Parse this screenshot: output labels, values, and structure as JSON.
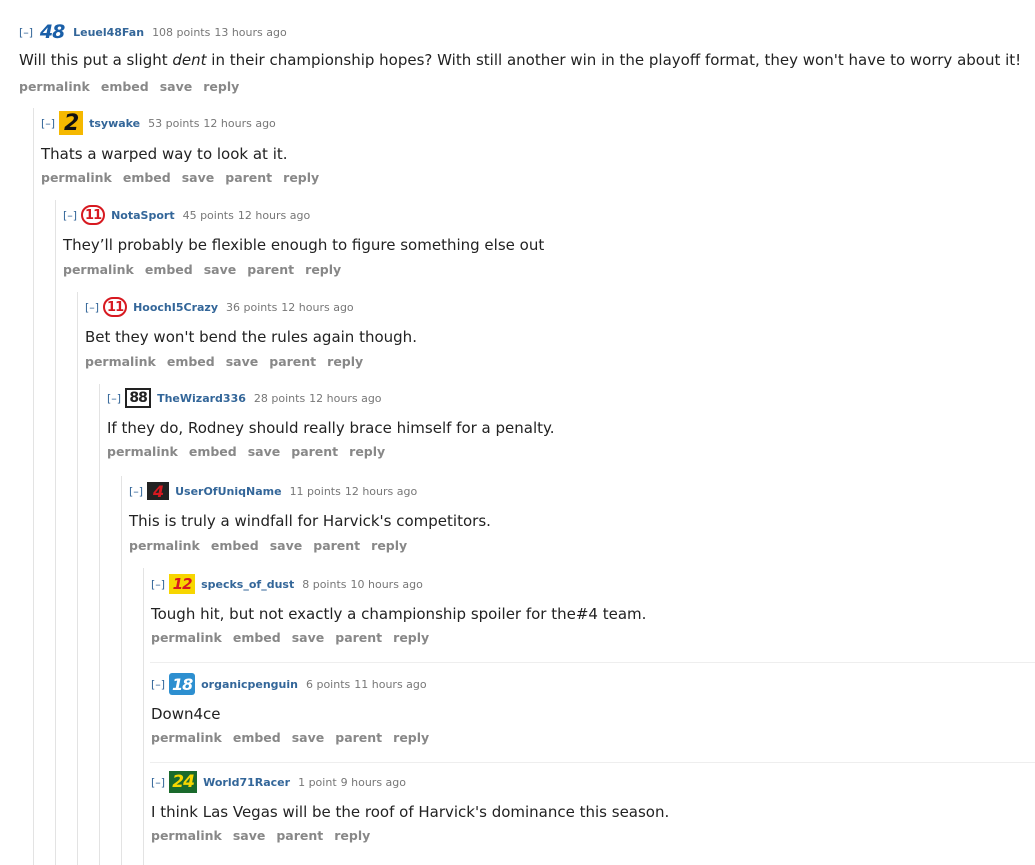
{
  "colors": {
    "link": "#336699",
    "muted": "#888888",
    "rail": "#e3e3e3"
  },
  "collapse_label": "[–]",
  "comments": [
    {
      "author": "Leuel48Fan",
      "points": "108 points",
      "time": "13 hours ago",
      "flair": {
        "text": "48",
        "icon": "flair-48-icon",
        "bg": "#ffffff",
        "fg": "#1a5fa8"
      },
      "body_pre": "Will this put a slight ",
      "body_em": "dent",
      "body_post": " in their championship hopes? With still another win in the playoff format, they won't have to worry about it!",
      "buttons": [
        "permalink",
        "embed",
        "save",
        "reply"
      ]
    },
    {
      "author": "tsywake",
      "points": "53 points",
      "time": "12 hours ago",
      "flair": {
        "text": "2",
        "icon": "flair-2-icon",
        "bg": "#f5b800",
        "fg": "#111111"
      },
      "body": "Thats a warped way to look at it.",
      "buttons": [
        "permalink",
        "embed",
        "save",
        "parent",
        "reply"
      ]
    },
    {
      "author": "NotaSport",
      "points": "45 points",
      "time": "12 hours ago",
      "flair": {
        "text": "11",
        "icon": "flair-11-icon",
        "bg": "#ffffff",
        "fg": "#d71920"
      },
      "body": "They’ll probably be flexible enough to figure something else out",
      "buttons": [
        "permalink",
        "embed",
        "save",
        "parent",
        "reply"
      ]
    },
    {
      "author": "HoochI5Crazy",
      "points": "36 points",
      "time": "12 hours ago",
      "flair": {
        "text": "11",
        "icon": "flair-11-icon",
        "bg": "#ffffff",
        "fg": "#d71920"
      },
      "body": "Bet they won't bend the rules again though.",
      "buttons": [
        "permalink",
        "embed",
        "save",
        "parent",
        "reply"
      ]
    },
    {
      "author": "TheWizard336",
      "points": "28 points",
      "time": "12 hours ago",
      "flair": {
        "text": "88",
        "icon": "flair-88-icon",
        "bg": "#ffffff",
        "fg": "#222222"
      },
      "body": "If they do, Rodney should really brace himself for a penalty.",
      "buttons": [
        "permalink",
        "embed",
        "save",
        "parent",
        "reply"
      ]
    },
    {
      "author": "UserOfUniqName",
      "points": "11 points",
      "time": "12 hours ago",
      "flair": {
        "text": "4",
        "icon": "flair-4-icon",
        "bg": "#222222",
        "fg": "#d71920"
      },
      "body": "This is truly a windfall for Harvick's competitors.",
      "buttons": [
        "permalink",
        "embed",
        "save",
        "parent",
        "reply"
      ]
    },
    {
      "author": "specks_of_dust",
      "points": "8 points",
      "time": "10 hours ago",
      "flair": {
        "text": "12",
        "icon": "flair-12-icon",
        "bg": "#f7d600",
        "fg": "#d71920"
      },
      "body": "Tough hit, but not exactly a championship spoiler for the#4 team.",
      "buttons": [
        "permalink",
        "embed",
        "save",
        "parent",
        "reply"
      ]
    },
    {
      "author": "organicpenguin",
      "points": "6 points",
      "time": "11 hours ago",
      "flair": {
        "text": "18",
        "icon": "flair-18-icon",
        "bg": "#2d8fd0",
        "fg": "#ffffff"
      },
      "body": "Down4ce",
      "buttons": [
        "permalink",
        "embed",
        "save",
        "parent",
        "reply"
      ]
    },
    {
      "author": "World71Racer",
      "points": "1 point",
      "time": "9 hours ago",
      "flair": {
        "text": "24",
        "icon": "flair-24-icon",
        "bg": "#1a6a2c",
        "fg": "#f7d600"
      },
      "body": "I think Las Vegas will be the roof of Harvick's dominance this season.",
      "buttons": [
        "permalink",
        "save",
        "parent",
        "reply"
      ]
    }
  ]
}
